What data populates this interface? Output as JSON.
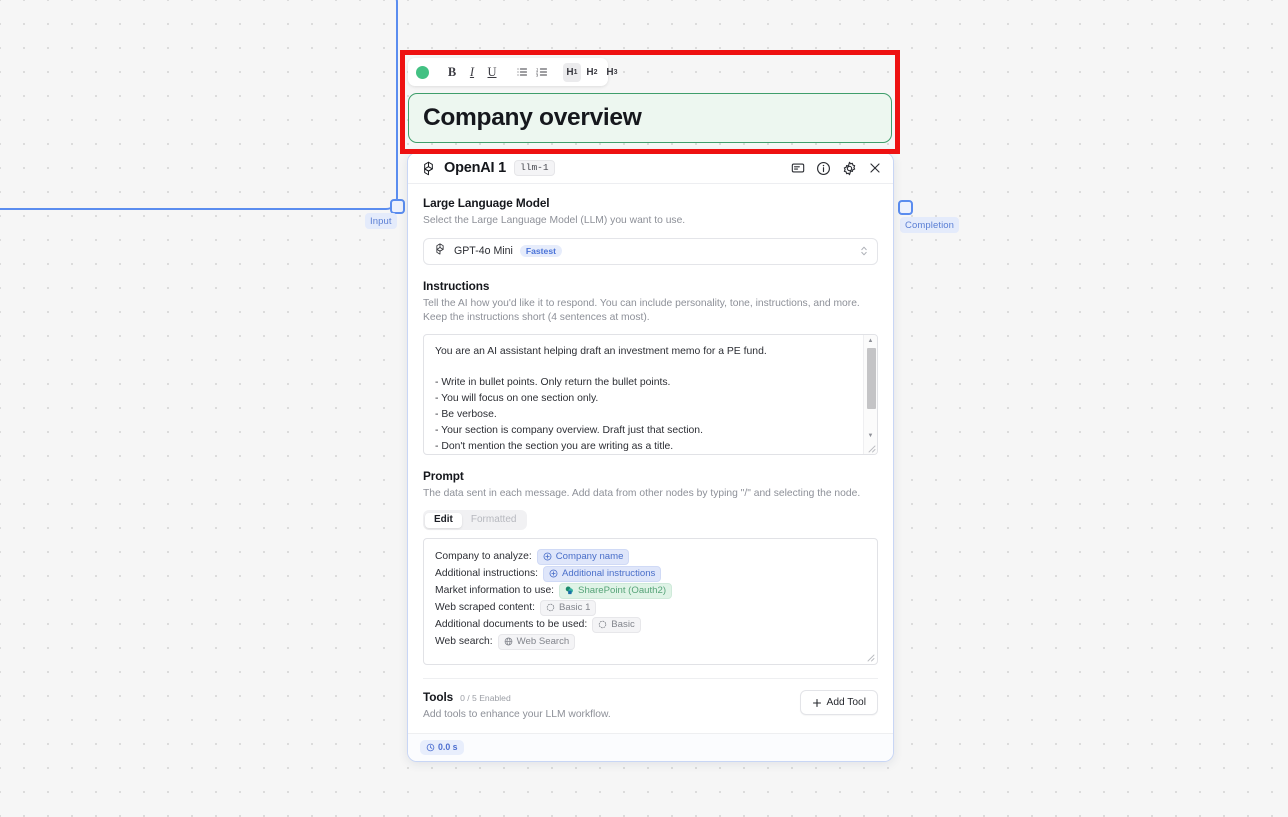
{
  "canvas": {
    "upstream_node": {
      "output_port_label": "Input"
    },
    "completion_port_label": "Completion"
  },
  "editor": {
    "toolbar": {
      "status_dot": "green-status-dot",
      "bold": "B",
      "italic": "I",
      "underline": "U",
      "bullet_list": "bullet-list-icon",
      "numbered_list": "numbered-list-icon",
      "h1": "H",
      "h1_sub": "1",
      "h2": "H",
      "h2_sub": "2",
      "h3": "H",
      "h3_sub": "3"
    },
    "title": "Company overview"
  },
  "llm_node": {
    "title": "OpenAI 1",
    "id_badge": "llm-1",
    "header_icons": [
      {
        "name": "note-icon"
      },
      {
        "name": "info-icon"
      },
      {
        "name": "gear-icon"
      },
      {
        "name": "close-icon"
      }
    ],
    "model_section": {
      "title": "Large Language Model",
      "description": "Select the Large Language Model (LLM) you want to use.",
      "selected_model": "GPT-4o Mini",
      "speed_badge": "Fastest"
    },
    "instructions_section": {
      "title": "Instructions",
      "description": "Tell the AI how you'd like it to respond. You can include personality, tone, instructions, and more. Keep the instructions short (4 sentences at most).",
      "value": "You are an AI assistant helping draft an investment memo for a PE fund.\n\n- Write in bullet points. Only return the bullet points.\n- You will focus on one section only.\n- Be verbose.\n- Your section is company overview. Draft just that section.\n- Don't mention the section you are writing as a title."
    },
    "prompt_section": {
      "title": "Prompt",
      "description": "The data sent in each message. Add data from other nodes by typing \"/\" and selecting the node.",
      "tabs": [
        {
          "label": "Edit",
          "active": true
        },
        {
          "label": "Formatted",
          "active": false
        }
      ],
      "lines": [
        {
          "label": "Company to analyze:",
          "pill": "Company name",
          "style": "blue",
          "icon": "circle-plus-icon"
        },
        {
          "label": "Additional instructions:",
          "pill": "Additional instructions",
          "style": "blue",
          "icon": "circle-plus-icon"
        },
        {
          "label": "Market information to use:",
          "pill": "SharePoint (Oauth2)",
          "style": "green",
          "icon": "sharepoint-icon"
        },
        {
          "label": "Web scraped content:",
          "pill": "Basic 1",
          "style": "gray",
          "icon": "dotted-circle-icon"
        },
        {
          "label": "Additional documents to be used:",
          "pill": "Basic",
          "style": "gray",
          "icon": "dotted-circle-icon"
        },
        {
          "label": "Web search:",
          "pill": "Web Search",
          "style": "gray",
          "icon": "globe-icon"
        }
      ]
    },
    "tools_section": {
      "title": "Tools",
      "count": "0 / 5 Enabled",
      "description": "Add tools to enhance your LLM workflow.",
      "add_button": "Add Tool"
    },
    "footer": {
      "runtime": "0.0 s"
    }
  },
  "colors": {
    "accent_blue": "#5b8def",
    "annotation_red": "#ee1111",
    "title_green": "#3f9e6b",
    "status_green": "#43c183"
  }
}
